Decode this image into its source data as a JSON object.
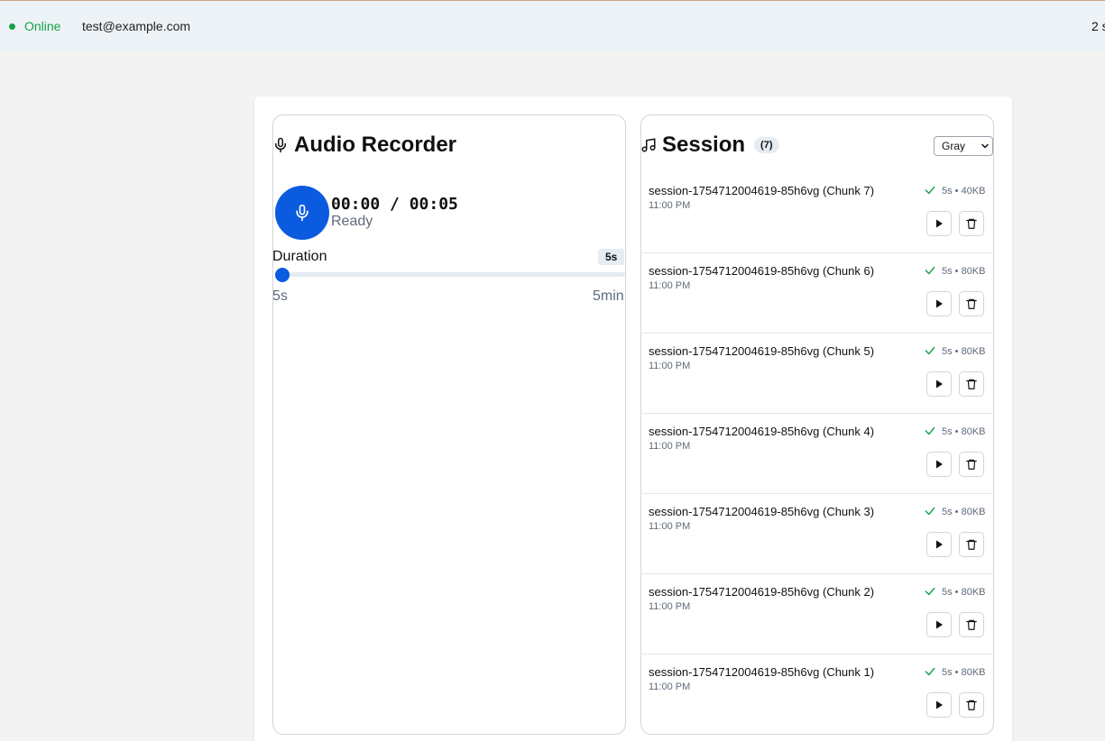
{
  "topbar": {
    "status": "Online",
    "user_email": "test@example.com",
    "right_text": "2 s"
  },
  "recorder": {
    "title": "Audio Recorder",
    "title_icon": "microphone-icon",
    "record_button_icon": "microphone-icon",
    "timer": "00:00 / 00:05",
    "status": "Ready",
    "duration_label": "Duration",
    "duration_badge": "5s",
    "slider": {
      "min_label": "5s",
      "max_label": "5min",
      "min_seconds": 5,
      "max_seconds": 300,
      "value_seconds": 5
    }
  },
  "session": {
    "title": "Session",
    "title_icon": "music-note-icon",
    "count": "(7)",
    "theme_select": {
      "selected": "Gray",
      "options": [
        "Gray"
      ]
    },
    "chunks": [
      {
        "name": "session-1754712004619-85h6vg (Chunk 7)",
        "time": "11:00 PM",
        "meta": "5s • 40KB"
      },
      {
        "name": "session-1754712004619-85h6vg (Chunk 6)",
        "time": "11:00 PM",
        "meta": "5s • 80KB"
      },
      {
        "name": "session-1754712004619-85h6vg (Chunk 5)",
        "time": "11:00 PM",
        "meta": "5s • 80KB"
      },
      {
        "name": "session-1754712004619-85h6vg (Chunk 4)",
        "time": "11:00 PM",
        "meta": "5s • 80KB"
      },
      {
        "name": "session-1754712004619-85h6vg (Chunk 3)",
        "time": "11:00 PM",
        "meta": "5s • 80KB"
      },
      {
        "name": "session-1754712004619-85h6vg (Chunk 2)",
        "time": "11:00 PM",
        "meta": "5s • 80KB"
      },
      {
        "name": "session-1754712004619-85h6vg (Chunk 1)",
        "time": "11:00 PM",
        "meta": "5s • 80KB"
      }
    ]
  },
  "colors": {
    "accent": "#0b5be0",
    "online": "#16a34a",
    "check": "#16a34a",
    "muted_text": "#5f6b7a"
  }
}
